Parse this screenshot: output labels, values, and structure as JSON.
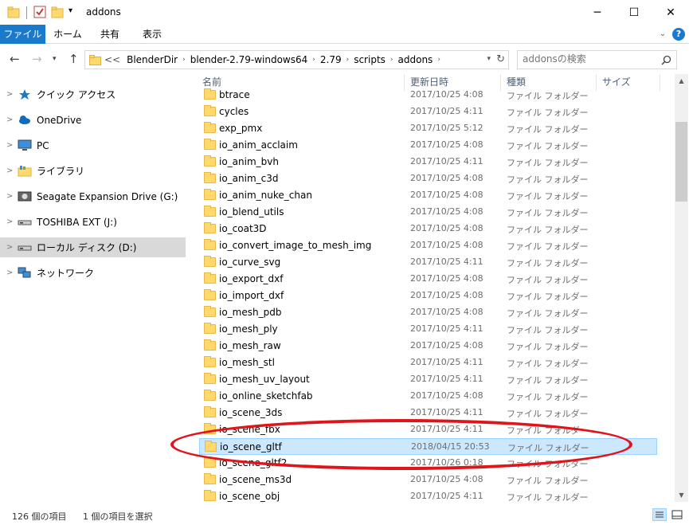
{
  "window": {
    "title": "addons",
    "minimize": "─",
    "maximize": "☐",
    "close": "✕"
  },
  "ribbon": {
    "tabs": [
      "ファイル",
      "ホーム",
      "共有",
      "表示"
    ],
    "expand": "⌄",
    "help": "?"
  },
  "address": {
    "overflow": "<<",
    "crumbs": [
      "BlenderDir",
      "blender-2.79-windows64",
      "2.79",
      "scripts",
      "addons"
    ],
    "search_placeholder": "addonsの検索"
  },
  "nav_pane": {
    "items": [
      {
        "label": "クイック アクセス",
        "icon": "star-icon"
      },
      {
        "label": "OneDrive",
        "icon": "cloud-icon"
      },
      {
        "label": "PC",
        "icon": "pc-icon"
      },
      {
        "label": "ライブラリ",
        "icon": "library-icon"
      },
      {
        "label": "Seagate Expansion Drive (G:)",
        "icon": "drive-icon"
      },
      {
        "label": "TOSHIBA EXT (J:)",
        "icon": "drive-icon"
      },
      {
        "label": "ローカル ディスク (D:)",
        "icon": "disk-icon",
        "selected": true
      },
      {
        "label": "ネットワーク",
        "icon": "network-icon"
      }
    ]
  },
  "list": {
    "columns": [
      "名前",
      "更新日時",
      "種類",
      "サイズ"
    ],
    "rows": [
      {
        "name": "btrace",
        "date": "2017/10/25 4:08",
        "type": "ファイル フォルダー"
      },
      {
        "name": "cycles",
        "date": "2017/10/25 4:11",
        "type": "ファイル フォルダー"
      },
      {
        "name": "exp_pmx",
        "date": "2017/10/25 5:12",
        "type": "ファイル フォルダー"
      },
      {
        "name": "io_anim_acclaim",
        "date": "2017/10/25 4:08",
        "type": "ファイル フォルダー"
      },
      {
        "name": "io_anim_bvh",
        "date": "2017/10/25 4:11",
        "type": "ファイル フォルダー"
      },
      {
        "name": "io_anim_c3d",
        "date": "2017/10/25 4:08",
        "type": "ファイル フォルダー"
      },
      {
        "name": "io_anim_nuke_chan",
        "date": "2017/10/25 4:08",
        "type": "ファイル フォルダー"
      },
      {
        "name": "io_blend_utils",
        "date": "2017/10/25 4:08",
        "type": "ファイル フォルダー"
      },
      {
        "name": "io_coat3D",
        "date": "2017/10/25 4:08",
        "type": "ファイル フォルダー"
      },
      {
        "name": "io_convert_image_to_mesh_img",
        "date": "2017/10/25 4:08",
        "type": "ファイル フォルダー"
      },
      {
        "name": "io_curve_svg",
        "date": "2017/10/25 4:11",
        "type": "ファイル フォルダー"
      },
      {
        "name": "io_export_dxf",
        "date": "2017/10/25 4:08",
        "type": "ファイル フォルダー"
      },
      {
        "name": "io_import_dxf",
        "date": "2017/10/25 4:08",
        "type": "ファイル フォルダー"
      },
      {
        "name": "io_mesh_pdb",
        "date": "2017/10/25 4:08",
        "type": "ファイル フォルダー"
      },
      {
        "name": "io_mesh_ply",
        "date": "2017/10/25 4:11",
        "type": "ファイル フォルダー"
      },
      {
        "name": "io_mesh_raw",
        "date": "2017/10/25 4:08",
        "type": "ファイル フォルダー"
      },
      {
        "name": "io_mesh_stl",
        "date": "2017/10/25 4:11",
        "type": "ファイル フォルダー"
      },
      {
        "name": "io_mesh_uv_layout",
        "date": "2017/10/25 4:11",
        "type": "ファイル フォルダー"
      },
      {
        "name": "io_online_sketchfab",
        "date": "2017/10/25 4:08",
        "type": "ファイル フォルダー"
      },
      {
        "name": "io_scene_3ds",
        "date": "2017/10/25 4:11",
        "type": "ファイル フォルダー"
      },
      {
        "name": "io_scene_fbx",
        "date": "2017/10/25 4:11",
        "type": "ファイル フォルダー"
      },
      {
        "name": "io_scene_gltf",
        "date": "2018/04/15 20:53",
        "type": "ファイル フォルダー",
        "selected": true
      },
      {
        "name": "io_scene_gltf2",
        "date": "2017/10/26 0:18",
        "type": "ファイル フォルダー"
      },
      {
        "name": "io_scene_ms3d",
        "date": "2017/10/25 4:08",
        "type": "ファイル フォルダー"
      },
      {
        "name": "io_scene_obj",
        "date": "2017/10/25 4:11",
        "type": "ファイル フォルダー"
      }
    ]
  },
  "status": {
    "count": "126 個の項目",
    "selected": "1 個の項目を選択"
  },
  "colors": {
    "accent": "#1979ca",
    "selection": "#cce8ff",
    "annotation": "#e0141b",
    "folder": "#ffd96b"
  }
}
